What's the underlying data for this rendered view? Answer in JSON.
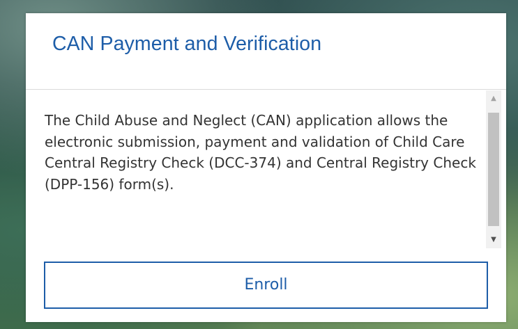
{
  "card": {
    "title": "CAN Payment and Verification",
    "description": "The Child Abuse and Neglect (CAN) application allows the electronic submission, payment and validation of Child Care Central Registry Check (DCC-374) and Central Registry Check (DPP-156) form(s).",
    "enroll_label": "Enroll"
  },
  "scrollbar": {
    "up_icon": "▲",
    "down_icon": "▼"
  },
  "colors": {
    "accent": "#1d5da8",
    "text": "#333333"
  }
}
